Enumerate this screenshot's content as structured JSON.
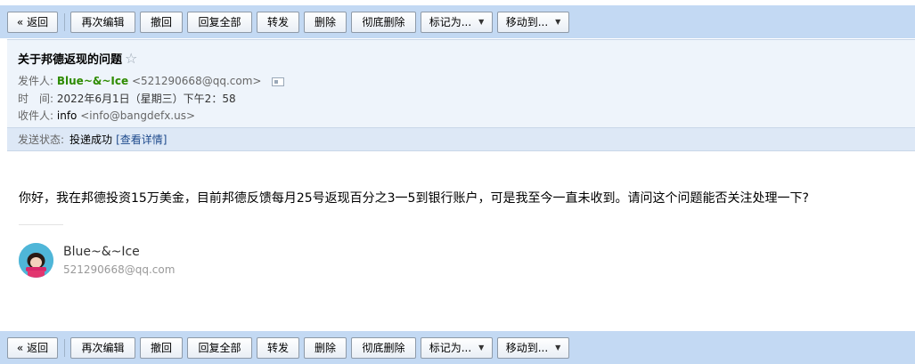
{
  "toolbar": {
    "back": "« 返回",
    "edit_again": "再次编辑",
    "recall": "撤回",
    "reply_all": "回复全部",
    "forward": "转发",
    "delete": "删除",
    "delete_permanently": "彻底删除",
    "mark_as": "标记为...",
    "move_to": "移动到..."
  },
  "mail": {
    "subject": "关于邦德返现的问题",
    "from_label": "发件人:",
    "from_name": "Blue~&~Ice",
    "from_address": "<521290668@qq.com>",
    "time_label": "时　间:",
    "time_value": "2022年6月1日（星期三）下午2：58",
    "to_label": "收件人:",
    "to_name": "info",
    "to_address": "<info@bangdefx.us>",
    "status_label": "发送状态:",
    "status_value": "投递成功",
    "status_link": "[查看详情]",
    "body": "你好，我在邦德投资15万美金，目前邦德反馈每月25号返现百分之3一5到银行账户，可是我至今一直未收到。请问这个问题能否关注处理一下?",
    "signature_name": "Blue~&~Ice",
    "signature_email": "521290668@qq.com"
  },
  "colors": {
    "toolbar_bg": "#c3d9f3",
    "header_bg": "#eef4fb",
    "sender_green": "#2e8b00",
    "link_blue": "#1e4a8c"
  }
}
